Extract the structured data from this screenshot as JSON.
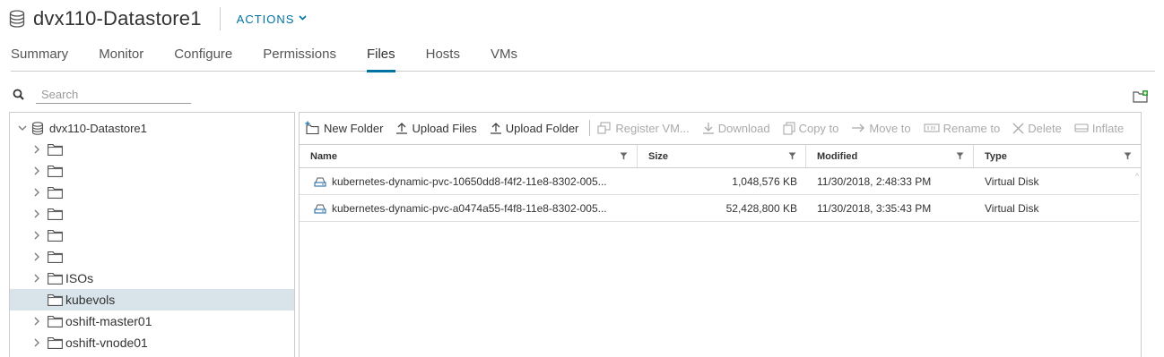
{
  "header": {
    "title": "dvx110-Datastore1",
    "actions_label": "ACTIONS"
  },
  "tabs": [
    {
      "label": "Summary"
    },
    {
      "label": "Monitor"
    },
    {
      "label": "Configure"
    },
    {
      "label": "Permissions"
    },
    {
      "label": "Files",
      "active": true
    },
    {
      "label": "Hosts"
    },
    {
      "label": "VMs"
    }
  ],
  "search": {
    "placeholder": "Search",
    "value": ""
  },
  "tree": {
    "root": "dvx110-Datastore1",
    "items": [
      {
        "label": "",
        "expandable": true
      },
      {
        "label": "",
        "expandable": true
      },
      {
        "label": "",
        "expandable": true
      },
      {
        "label": "",
        "expandable": true
      },
      {
        "label": "",
        "expandable": true
      },
      {
        "label": "",
        "expandable": true
      },
      {
        "label": "ISOs",
        "expandable": true
      },
      {
        "label": "kubevols",
        "expandable": false,
        "selected": true
      },
      {
        "label": "oshift-master01",
        "expandable": true
      },
      {
        "label": "oshift-vnode01",
        "expandable": true
      }
    ]
  },
  "toolbar": {
    "new_folder": "New Folder",
    "upload_files": "Upload Files",
    "upload_folder": "Upload Folder",
    "register_vm": "Register VM...",
    "download": "Download",
    "copy_to": "Copy to",
    "move_to": "Move to",
    "rename_to": "Rename to",
    "delete": "Delete",
    "inflate": "Inflate"
  },
  "grid": {
    "columns": [
      "Name",
      "Size",
      "Modified",
      "Type"
    ],
    "rows": [
      {
        "name": "kubernetes-dynamic-pvc-10650dd8-f4f2-11e8-8302-005...",
        "size": "1,048,576 KB",
        "modified": "11/30/2018, 2:48:33 PM",
        "type": "Virtual Disk"
      },
      {
        "name": "kubernetes-dynamic-pvc-a0474a55-f4f8-11e8-8302-005...",
        "size": "52,428,800 KB",
        "modified": "11/30/2018, 3:35:43 PM",
        "type": "Virtual Disk"
      }
    ]
  },
  "colors": {
    "accent": "#0072a3",
    "selected_row": "#d9e4ea",
    "border": "#cccccc"
  }
}
